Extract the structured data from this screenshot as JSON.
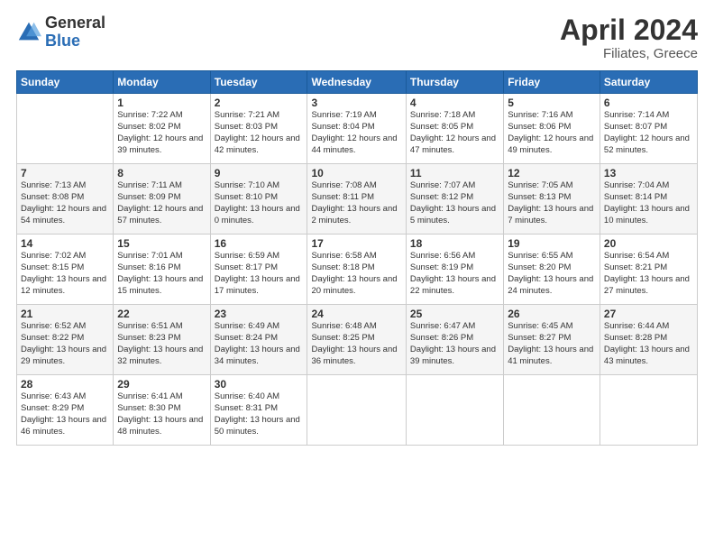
{
  "logo": {
    "general": "General",
    "blue": "Blue"
  },
  "title": {
    "month": "April 2024",
    "location": "Filiates, Greece"
  },
  "weekdays": [
    "Sunday",
    "Monday",
    "Tuesday",
    "Wednesday",
    "Thursday",
    "Friday",
    "Saturday"
  ],
  "weeks": [
    [
      {
        "day": "",
        "info": ""
      },
      {
        "day": "1",
        "info": "Sunrise: 7:22 AM\nSunset: 8:02 PM\nDaylight: 12 hours\nand 39 minutes."
      },
      {
        "day": "2",
        "info": "Sunrise: 7:21 AM\nSunset: 8:03 PM\nDaylight: 12 hours\nand 42 minutes."
      },
      {
        "day": "3",
        "info": "Sunrise: 7:19 AM\nSunset: 8:04 PM\nDaylight: 12 hours\nand 44 minutes."
      },
      {
        "day": "4",
        "info": "Sunrise: 7:18 AM\nSunset: 8:05 PM\nDaylight: 12 hours\nand 47 minutes."
      },
      {
        "day": "5",
        "info": "Sunrise: 7:16 AM\nSunset: 8:06 PM\nDaylight: 12 hours\nand 49 minutes."
      },
      {
        "day": "6",
        "info": "Sunrise: 7:14 AM\nSunset: 8:07 PM\nDaylight: 12 hours\nand 52 minutes."
      }
    ],
    [
      {
        "day": "7",
        "info": "Sunrise: 7:13 AM\nSunset: 8:08 PM\nDaylight: 12 hours\nand 54 minutes."
      },
      {
        "day": "8",
        "info": "Sunrise: 7:11 AM\nSunset: 8:09 PM\nDaylight: 12 hours\nand 57 minutes."
      },
      {
        "day": "9",
        "info": "Sunrise: 7:10 AM\nSunset: 8:10 PM\nDaylight: 13 hours\nand 0 minutes."
      },
      {
        "day": "10",
        "info": "Sunrise: 7:08 AM\nSunset: 8:11 PM\nDaylight: 13 hours\nand 2 minutes."
      },
      {
        "day": "11",
        "info": "Sunrise: 7:07 AM\nSunset: 8:12 PM\nDaylight: 13 hours\nand 5 minutes."
      },
      {
        "day": "12",
        "info": "Sunrise: 7:05 AM\nSunset: 8:13 PM\nDaylight: 13 hours\nand 7 minutes."
      },
      {
        "day": "13",
        "info": "Sunrise: 7:04 AM\nSunset: 8:14 PM\nDaylight: 13 hours\nand 10 minutes."
      }
    ],
    [
      {
        "day": "14",
        "info": "Sunrise: 7:02 AM\nSunset: 8:15 PM\nDaylight: 13 hours\nand 12 minutes."
      },
      {
        "day": "15",
        "info": "Sunrise: 7:01 AM\nSunset: 8:16 PM\nDaylight: 13 hours\nand 15 minutes."
      },
      {
        "day": "16",
        "info": "Sunrise: 6:59 AM\nSunset: 8:17 PM\nDaylight: 13 hours\nand 17 minutes."
      },
      {
        "day": "17",
        "info": "Sunrise: 6:58 AM\nSunset: 8:18 PM\nDaylight: 13 hours\nand 20 minutes."
      },
      {
        "day": "18",
        "info": "Sunrise: 6:56 AM\nSunset: 8:19 PM\nDaylight: 13 hours\nand 22 minutes."
      },
      {
        "day": "19",
        "info": "Sunrise: 6:55 AM\nSunset: 8:20 PM\nDaylight: 13 hours\nand 24 minutes."
      },
      {
        "day": "20",
        "info": "Sunrise: 6:54 AM\nSunset: 8:21 PM\nDaylight: 13 hours\nand 27 minutes."
      }
    ],
    [
      {
        "day": "21",
        "info": "Sunrise: 6:52 AM\nSunset: 8:22 PM\nDaylight: 13 hours\nand 29 minutes."
      },
      {
        "day": "22",
        "info": "Sunrise: 6:51 AM\nSunset: 8:23 PM\nDaylight: 13 hours\nand 32 minutes."
      },
      {
        "day": "23",
        "info": "Sunrise: 6:49 AM\nSunset: 8:24 PM\nDaylight: 13 hours\nand 34 minutes."
      },
      {
        "day": "24",
        "info": "Sunrise: 6:48 AM\nSunset: 8:25 PM\nDaylight: 13 hours\nand 36 minutes."
      },
      {
        "day": "25",
        "info": "Sunrise: 6:47 AM\nSunset: 8:26 PM\nDaylight: 13 hours\nand 39 minutes."
      },
      {
        "day": "26",
        "info": "Sunrise: 6:45 AM\nSunset: 8:27 PM\nDaylight: 13 hours\nand 41 minutes."
      },
      {
        "day": "27",
        "info": "Sunrise: 6:44 AM\nSunset: 8:28 PM\nDaylight: 13 hours\nand 43 minutes."
      }
    ],
    [
      {
        "day": "28",
        "info": "Sunrise: 6:43 AM\nSunset: 8:29 PM\nDaylight: 13 hours\nand 46 minutes."
      },
      {
        "day": "29",
        "info": "Sunrise: 6:41 AM\nSunset: 8:30 PM\nDaylight: 13 hours\nand 48 minutes."
      },
      {
        "day": "30",
        "info": "Sunrise: 6:40 AM\nSunset: 8:31 PM\nDaylight: 13 hours\nand 50 minutes."
      },
      {
        "day": "",
        "info": ""
      },
      {
        "day": "",
        "info": ""
      },
      {
        "day": "",
        "info": ""
      },
      {
        "day": "",
        "info": ""
      }
    ]
  ]
}
